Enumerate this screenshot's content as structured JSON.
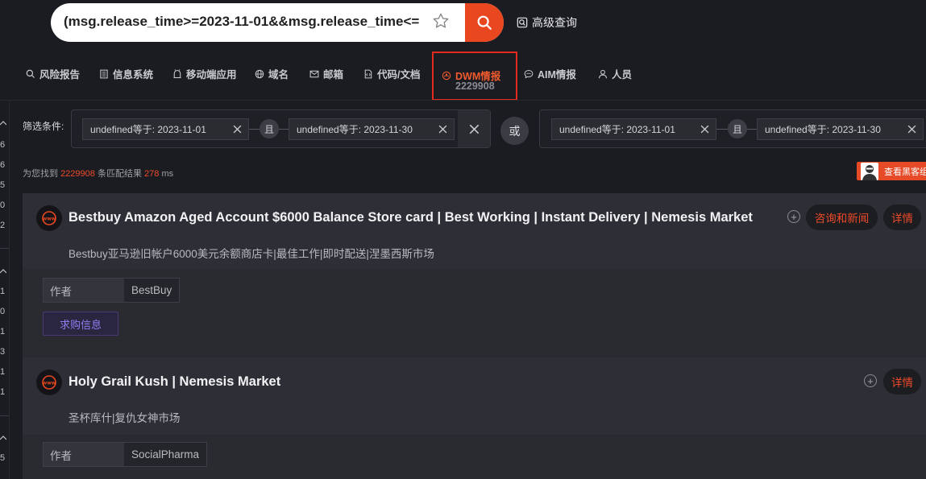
{
  "search": {
    "query": "(msg.release_time>=2023-11-01&&msg.release_time<=",
    "advanced_label": "高级查询"
  },
  "nav": {
    "tabs": [
      {
        "label": "风险报告",
        "icon": "search-icon"
      },
      {
        "label": "信息系统",
        "icon": "document-icon"
      },
      {
        "label": "移动端应用",
        "icon": "mobile-app-icon"
      },
      {
        "label": "域名",
        "icon": "globe-icon"
      },
      {
        "label": "邮箱",
        "icon": "mail-icon"
      },
      {
        "label": "代码/文档",
        "icon": "code-file-icon"
      },
      {
        "label": "DWM情报",
        "count": "2229908",
        "icon": "dwm-icon",
        "active": true
      },
      {
        "label": "AIM情报",
        "icon": "chat-icon"
      },
      {
        "label": "人员",
        "icon": "person-icon"
      }
    ]
  },
  "gutter": {
    "numbers": [
      "6",
      "6",
      "5",
      "0",
      "2",
      "1",
      "0",
      "1",
      "3",
      "1",
      "1",
      "5"
    ]
  },
  "filter": {
    "label": "筛选条件:",
    "groups": [
      {
        "chips": [
          "undefined等于: 2023-11-01",
          "undefined等于: 2023-11-30"
        ],
        "join": "且"
      },
      {
        "chips": [
          "undefined等于: 2023-11-01",
          "undefined等于: 2023-11-30"
        ],
        "join": "且"
      }
    ],
    "or_label": "或"
  },
  "results": {
    "prefix": "为您找到",
    "count": "2229908",
    "middle": "条匹配结果",
    "time": "278",
    "unit": "ms",
    "hacker_button": "查看黑客组"
  },
  "cards": [
    {
      "title": "Bestbuy Amazon Aged Account $6000 Balance Store card | Best Working | Instant Delivery | Nemesis Market",
      "translation": "Bestbuy亚马逊旧帐户6000美元余额商店卡|最佳工作|即时配送|涅墨西斯市场",
      "author_key": "作者",
      "author_value": "BestBuy",
      "tag": "求购信息",
      "actions": [
        "咨询和新闻",
        "详情"
      ]
    },
    {
      "title": "Holy Grail Kush | Nemesis Market",
      "translation": "圣杯库什|复仇女神市场",
      "author_key": "作者",
      "author_value": "SocialPharma",
      "actions": [
        "详情"
      ]
    }
  ],
  "colors": {
    "accent": "#e8471f",
    "highlight_border": "#e52a20",
    "background": "#1b1c21",
    "tag_purple": "#8f7df0"
  }
}
